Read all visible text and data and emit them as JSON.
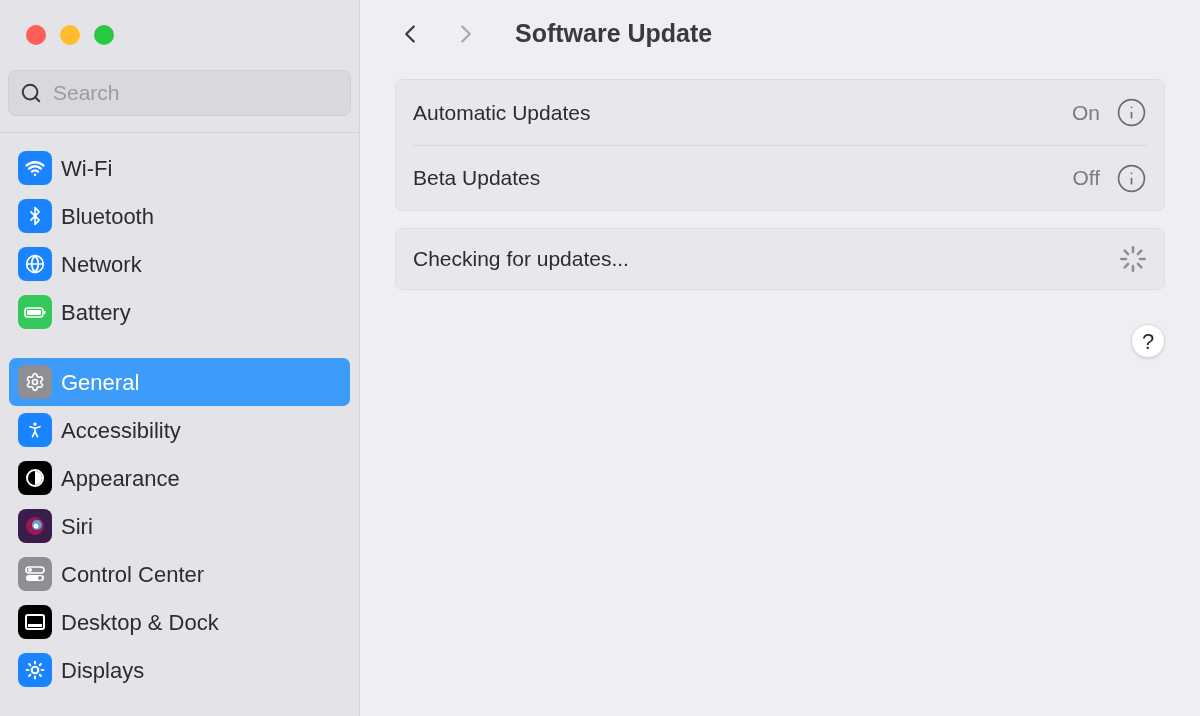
{
  "search": {
    "placeholder": "Search"
  },
  "sidebar": {
    "groups": [
      {
        "items": [
          {
            "label": "Wi-Fi",
            "kind": "wifi",
            "selected": false
          },
          {
            "label": "Bluetooth",
            "kind": "bluetooth",
            "selected": false
          },
          {
            "label": "Network",
            "kind": "network",
            "selected": false
          },
          {
            "label": "Battery",
            "kind": "battery",
            "selected": false
          }
        ]
      },
      {
        "items": [
          {
            "label": "General",
            "kind": "general",
            "selected": true
          },
          {
            "label": "Accessibility",
            "kind": "accessibility",
            "selected": false
          },
          {
            "label": "Appearance",
            "kind": "appearance",
            "selected": false
          },
          {
            "label": "Siri",
            "kind": "siri",
            "selected": false
          },
          {
            "label": "Control Center",
            "kind": "control",
            "selected": false
          },
          {
            "label": "Desktop & Dock",
            "kind": "desktop",
            "selected": false
          },
          {
            "label": "Displays",
            "kind": "displays",
            "selected": false
          }
        ]
      }
    ]
  },
  "toolbar": {
    "back_disabled": false,
    "forward_disabled": true,
    "title": "Software Update"
  },
  "settings": [
    {
      "label": "Automatic Updates",
      "value": "On"
    },
    {
      "label": "Beta Updates",
      "value": "Off"
    }
  ],
  "status": {
    "label": "Checking for updates..."
  },
  "help": "?"
}
